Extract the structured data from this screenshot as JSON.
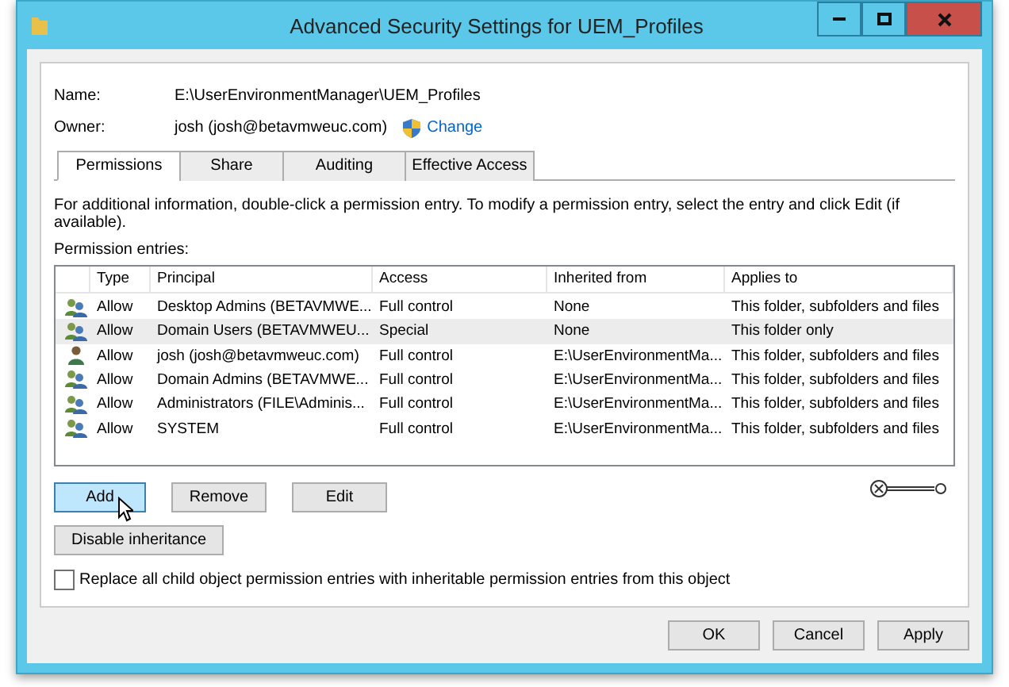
{
  "window": {
    "title": "Advanced Security Settings for UEM_Profiles"
  },
  "name": {
    "label": "Name:",
    "value": "E:\\UserEnvironmentManager\\UEM_Profiles"
  },
  "owner": {
    "label": "Owner:",
    "value": "josh (josh@betavmweuc.com)",
    "link": "Change"
  },
  "tabs": [
    {
      "label": "Permissions",
      "selected": true
    },
    {
      "label": "Share",
      "selected": false
    },
    {
      "label": "Auditing",
      "selected": false
    },
    {
      "label": "Effective Access",
      "selected": false
    }
  ],
  "info": "For additional information, double-click a permission entry. To modify a permission entry, select the entry and click Edit (if available).",
  "entries_label": "Permission entries:",
  "table": {
    "columns": [
      "Type",
      "Principal",
      "Access",
      "Inherited from",
      "Applies to"
    ],
    "rows": [
      {
        "kind": "group",
        "selected": false,
        "cells": [
          "Allow",
          "Desktop Admins (BETAVMWE...",
          "Full control",
          "None",
          "This folder, subfolders and files"
        ]
      },
      {
        "kind": "group",
        "selected": true,
        "cells": [
          "Allow",
          "Domain Users (BETAVMWEU...",
          "Special",
          "None",
          "This folder only"
        ]
      },
      {
        "kind": "user",
        "selected": false,
        "cells": [
          "Allow",
          "josh (josh@betavmweuc.com)",
          "Full control",
          "E:\\UserEnvironmentMa...",
          "This folder, subfolders and files"
        ]
      },
      {
        "kind": "group",
        "selected": false,
        "cells": [
          "Allow",
          "Domain Admins (BETAVMWE...",
          "Full control",
          "E:\\UserEnvironmentMa...",
          "This folder, subfolders and files"
        ]
      },
      {
        "kind": "group",
        "selected": false,
        "cells": [
          "Allow",
          "Administrators (FILE\\Adminis...",
          "Full control",
          "E:\\UserEnvironmentMa...",
          "This folder, subfolders and files"
        ]
      },
      {
        "kind": "group",
        "selected": false,
        "cells": [
          "Allow",
          "SYSTEM",
          "Full control",
          "E:\\UserEnvironmentMa...",
          "This folder, subfolders and files"
        ]
      }
    ]
  },
  "entry_buttons": [
    {
      "label": "Add",
      "hovered": true
    },
    {
      "label": "Remove",
      "hovered": false
    },
    {
      "label": "Edit",
      "hovered": false
    }
  ],
  "inheritance_button": "Disable inheritance",
  "replace_checkbox": {
    "label": "Replace all child object permission entries with inheritable permission entries from this object",
    "checked": false
  },
  "dialog_buttons": [
    "OK",
    "Cancel",
    "Apply"
  ]
}
